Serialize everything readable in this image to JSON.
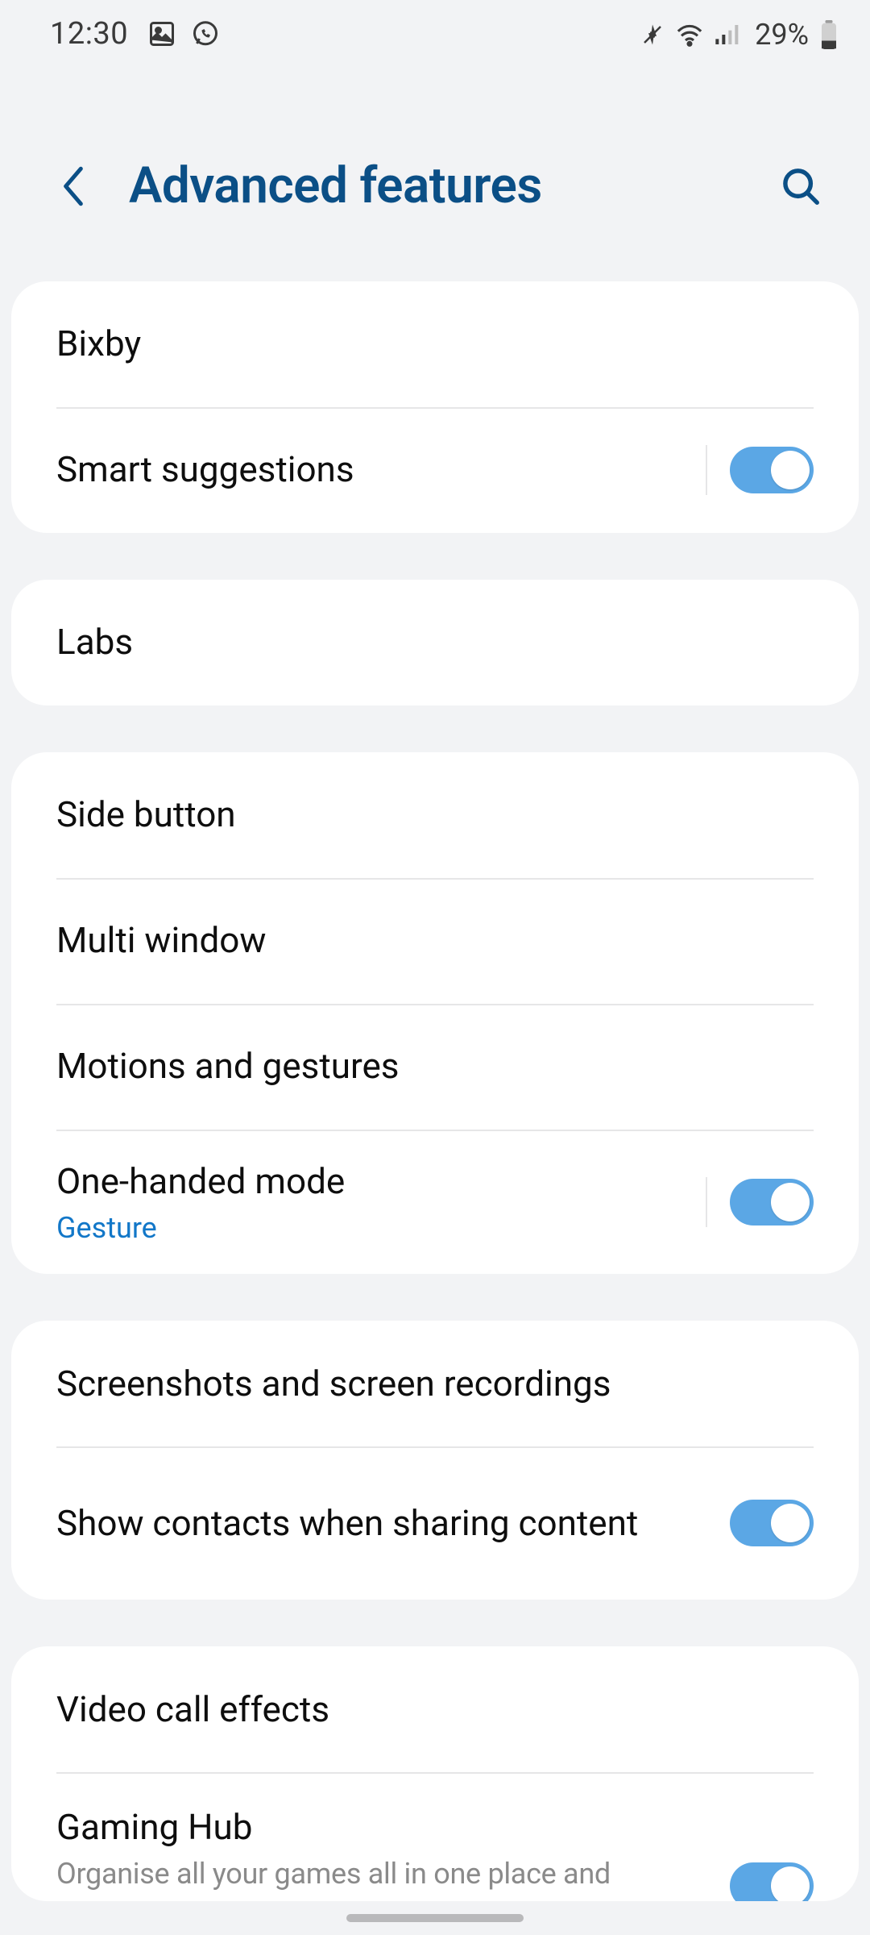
{
  "status": {
    "time": "12:30",
    "battery_pct": "29%"
  },
  "header": {
    "title": "Advanced features"
  },
  "groups": [
    {
      "items": [
        {
          "label": "Bixby"
        },
        {
          "label": "Smart suggestions",
          "toggle": true,
          "sep": true
        }
      ]
    },
    {
      "items": [
        {
          "label": "Labs"
        }
      ]
    },
    {
      "items": [
        {
          "label": "Side button"
        },
        {
          "label": "Multi window"
        },
        {
          "label": "Motions and gestures"
        },
        {
          "label": "One-handed mode",
          "sub": "Gesture",
          "toggle": true,
          "sep": true
        }
      ]
    },
    {
      "items": [
        {
          "label": "Screenshots and screen recordings"
        },
        {
          "label": "Show contacts when sharing content",
          "toggle": true
        }
      ]
    },
    {
      "items": [
        {
          "label": "Video call effects"
        },
        {
          "label": "Gaming Hub",
          "subgray": "Organise all your games all in one place and",
          "toggle": true
        }
      ]
    }
  ]
}
